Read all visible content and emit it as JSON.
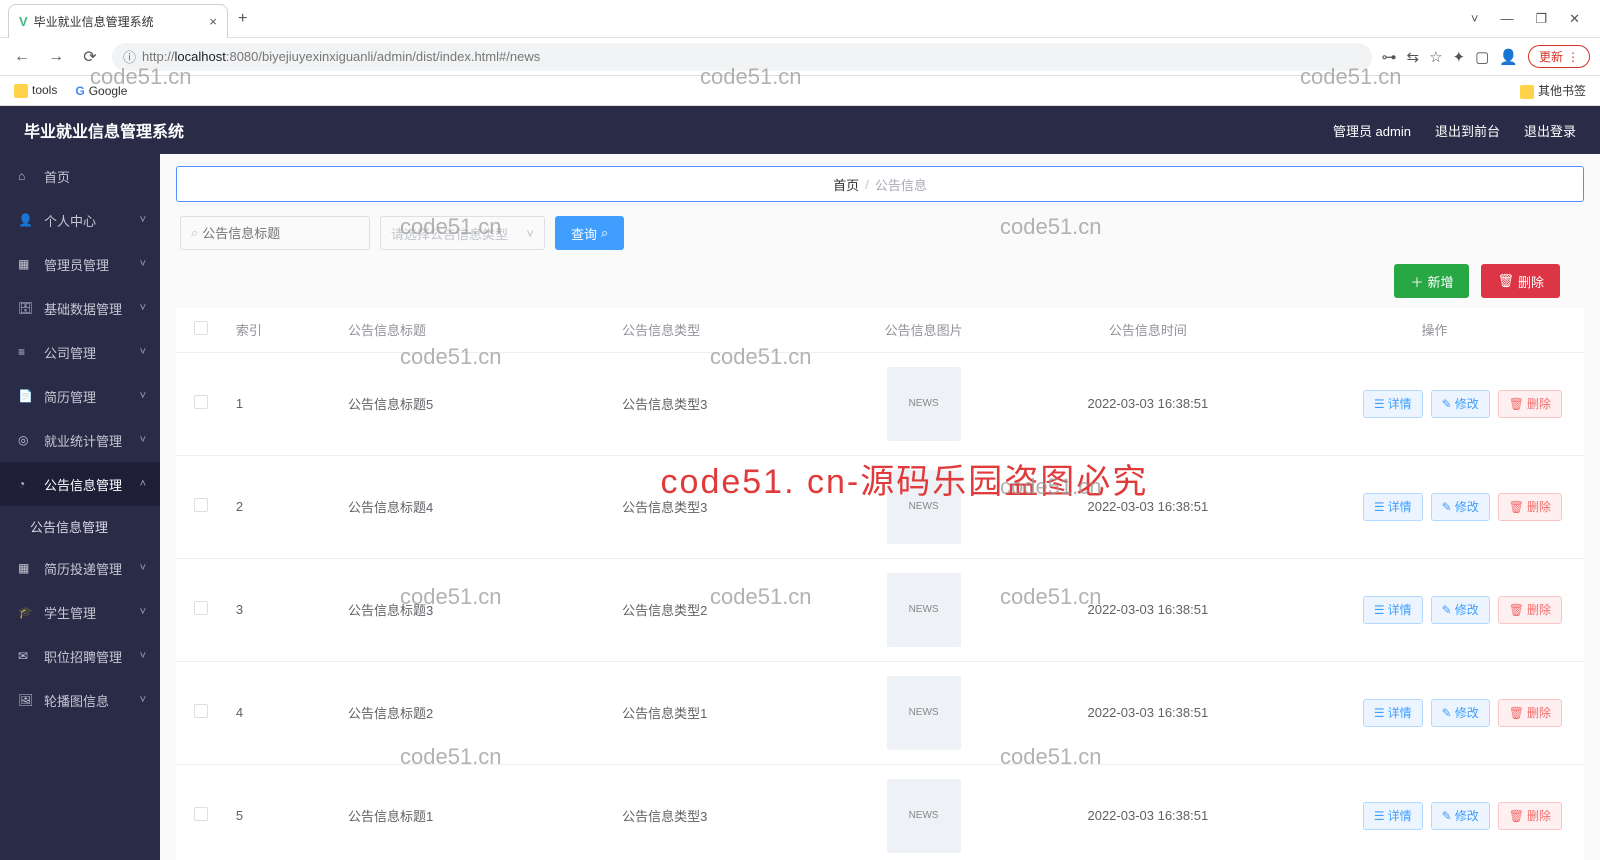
{
  "browser": {
    "tab_title": "毕业就业信息管理系统",
    "url_prefix": "http://",
    "url_host": "localhost",
    "url_rest": ":8080/biyejiuyexinxiguanli/admin/dist/index.html#/news",
    "update_label": "更新",
    "bm_tools": "tools",
    "bm_google": "Google",
    "bm_other": "其他书签"
  },
  "app": {
    "title": "毕业就业信息管理系统",
    "user_label": "管理员 admin",
    "front_label": "退出到前台",
    "logout_label": "退出登录"
  },
  "sidebar": {
    "items": [
      {
        "icon": "⌂",
        "label": "首页",
        "chev": ""
      },
      {
        "icon": "👤",
        "label": "个人中心",
        "chev": "˅"
      },
      {
        "icon": "▦",
        "label": "管理员管理",
        "chev": "˅"
      },
      {
        "icon": "🗄",
        "label": "基础数据管理",
        "chev": "˅"
      },
      {
        "icon": "≡",
        "label": "公司管理",
        "chev": "˅"
      },
      {
        "icon": "📄",
        "label": "简历管理",
        "chev": "˅"
      },
      {
        "icon": "◎",
        "label": "就业统计管理",
        "chev": "˅"
      },
      {
        "icon": "◔",
        "label": "公告信息管理",
        "chev": "˄"
      },
      {
        "icon": "▦",
        "label": "简历投递管理",
        "chev": "˅"
      },
      {
        "icon": "🎓",
        "label": "学生管理",
        "chev": "˅"
      },
      {
        "icon": "✉",
        "label": "职位招聘管理",
        "chev": "˅"
      },
      {
        "icon": "🖼",
        "label": "轮播图信息",
        "chev": "˅"
      }
    ],
    "sub_label": "公告信息管理"
  },
  "breadcrumb": {
    "home": "首页",
    "current": "公告信息"
  },
  "search": {
    "title_placeholder": "公告信息标题",
    "type_placeholder": "请选择公告信息类型",
    "query_label": "查询"
  },
  "actions": {
    "add_label": "新增",
    "del_label": "删除"
  },
  "table": {
    "headers": {
      "index": "索引",
      "title": "公告信息标题",
      "type": "公告信息类型",
      "image": "公告信息图片",
      "time": "公告信息时间",
      "ops": "操作"
    },
    "op_detail": "详情",
    "op_edit": "修改",
    "op_del": "删除",
    "rows": [
      {
        "idx": "1",
        "title": "公告信息标题5",
        "type": "公告信息类型3",
        "time": "2022-03-03 16:38:51"
      },
      {
        "idx": "2",
        "title": "公告信息标题4",
        "type": "公告信息类型3",
        "time": "2022-03-03 16:38:51"
      },
      {
        "idx": "3",
        "title": "公告信息标题3",
        "type": "公告信息类型2",
        "time": "2022-03-03 16:38:51"
      },
      {
        "idx": "4",
        "title": "公告信息标题2",
        "type": "公告信息类型1",
        "time": "2022-03-03 16:38:51"
      },
      {
        "idx": "5",
        "title": "公告信息标题1",
        "type": "公告信息类型3",
        "time": "2022-03-03 16:38:51"
      }
    ]
  },
  "watermark": {
    "small": "code51.cn",
    "big": "code51. cn-源码乐园盗图必究"
  }
}
